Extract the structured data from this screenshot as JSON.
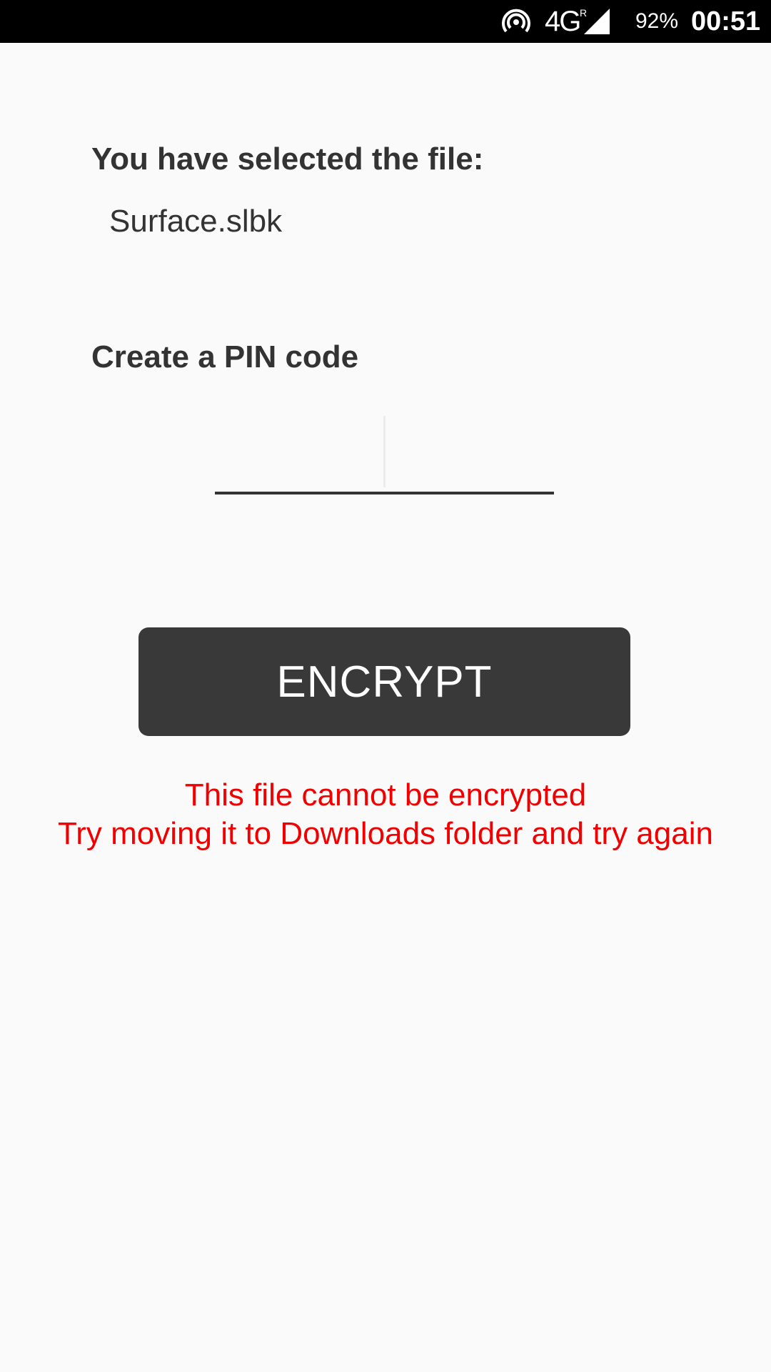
{
  "status_bar": {
    "hotspot_icon": "hotspot-icon",
    "network": "4G",
    "roaming": "R",
    "signal_icon": "signal-icon",
    "battery": "92%",
    "time": "00:51"
  },
  "main": {
    "selected_label": "You have selected the file:",
    "file_name": "Surface.slbk",
    "pin_label": "Create a PIN code",
    "pin_value": "",
    "encrypt_label": "ENCRYPT",
    "error_line1": "This file cannot be encrypted",
    "error_line2": "Try moving it to Downloads folder and try again"
  },
  "colors": {
    "background": "#fafafa",
    "text": "#333333",
    "button": "#393939",
    "error": "#f00000"
  }
}
